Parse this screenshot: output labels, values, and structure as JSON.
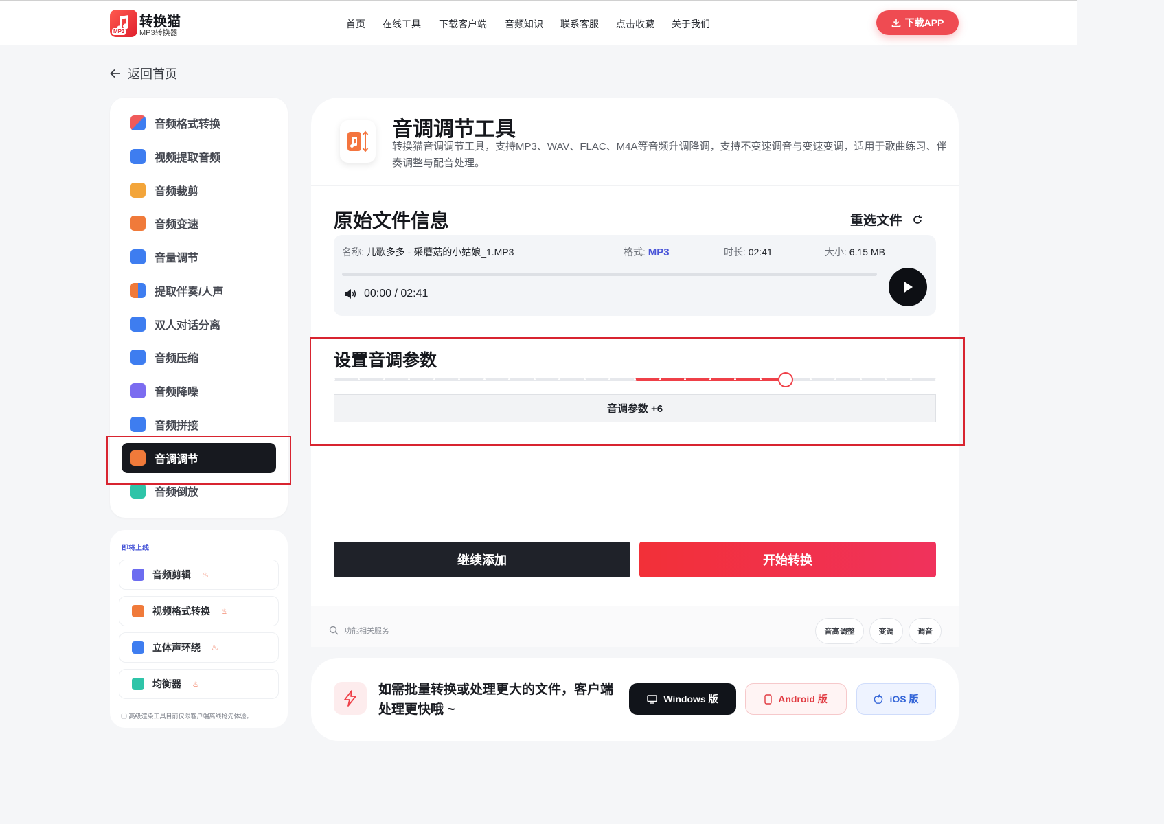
{
  "header": {
    "logo_name": "转换猫",
    "logo_sub": "MP3转换器",
    "logo_tag": "MP3",
    "nav": [
      "首页",
      "在线工具",
      "下载客户端",
      "音频知识",
      "联系客服",
      "点击收藏",
      "关于我们"
    ],
    "download_label": "下载APP"
  },
  "back_label": "返回首页",
  "sidebar": {
    "items": [
      {
        "label": "音频格式转换",
        "icon": "format-convert-icon",
        "color": "#f05a5a"
      },
      {
        "label": "视频提取音频",
        "icon": "video-extract-icon",
        "color": "#3e7df0"
      },
      {
        "label": "音频裁剪",
        "icon": "audio-trim-icon",
        "color": "#f3a53a"
      },
      {
        "label": "音频变速",
        "icon": "speed-icon",
        "color": "#f07a3a"
      },
      {
        "label": "音量调节",
        "icon": "volume-icon",
        "color": "#3e7df0"
      },
      {
        "label": "提取伴奏/人声",
        "icon": "vocal-icon",
        "color": "#f07a3a"
      },
      {
        "label": "双人对话分离",
        "icon": "dialogue-icon",
        "color": "#3e7df0"
      },
      {
        "label": "音频压缩",
        "icon": "compress-icon",
        "color": "#3e7df0"
      },
      {
        "label": "音频降噪",
        "icon": "denoise-icon",
        "color": "#7b6cf0"
      },
      {
        "label": "音频拼接",
        "icon": "merge-icon",
        "color": "#3e7df0"
      },
      {
        "label": "音调调节",
        "icon": "pitch-icon",
        "color": "#f07a3a"
      },
      {
        "label": "音频倒放",
        "icon": "reverse-icon",
        "color": "#2ec4a8"
      }
    ],
    "active_index": 10
  },
  "coming_soon": {
    "title": "即将上线",
    "items": [
      {
        "label": "音频剪辑",
        "icon": "scissors-icon",
        "color": "#6c6cf0"
      },
      {
        "label": "视频格式转换",
        "icon": "video-convert-icon",
        "color": "#f07a3a"
      },
      {
        "label": "立体声环绕",
        "icon": "surround-icon",
        "color": "#3e7df0"
      },
      {
        "label": "均衡器",
        "icon": "equalizer-icon",
        "color": "#2ec4a8"
      }
    ],
    "note": "ⓘ 高级渲染工具目前仅限客户端离线抢先体验。"
  },
  "tool": {
    "title": "音调调节工具",
    "description": "转换猫音调调节工具，支持MP3、WAV、FLAC、M4A等音频升调降调，支持不变速调音与变速变调，适用于歌曲练习、伴奏调整与配音处理。"
  },
  "file_section": {
    "title": "原始文件信息",
    "reselect_label": "重选文件",
    "name_label": "名称:",
    "name": "儿歌多多 - 采蘑菇的小姑娘_1.MP3",
    "format_label": "格式:",
    "format": "MP3",
    "duration_label": "时长:",
    "duration": "02:41",
    "size_label": "大小:",
    "size": "6.15 MB",
    "player_time": "00:00 / 02:41",
    "progress": 0
  },
  "pitch_section": {
    "title": "设置音调参数",
    "value": 6,
    "min": -12,
    "max": 12,
    "param_label": "音调参数 +6"
  },
  "actions": {
    "add_label": "继续添加",
    "start_label": "开始转换"
  },
  "related": {
    "label": "功能相关服务",
    "tags": [
      "音高调整",
      "变调",
      "调音"
    ]
  },
  "promo": {
    "text": "如需批量转换或处理更大的文件，客户端处理更快哦 ~",
    "windows": "Windows 版",
    "android": "Android 版",
    "ios": "iOS 版"
  },
  "colors": {
    "accent_red": "#ef4048",
    "dark": "#17191f",
    "link_blue": "#4a55d8"
  }
}
